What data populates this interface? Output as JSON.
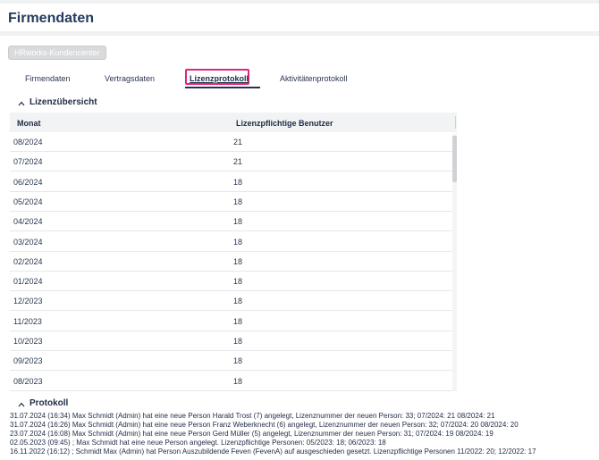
{
  "page": {
    "title": "Firmendaten"
  },
  "toolbar": {
    "kundencenter_label": "HRworks-Kundencenter"
  },
  "tabs": [
    {
      "label": "Firmendaten"
    },
    {
      "label": "Vertragsdaten"
    },
    {
      "label": "Lizenzprotokoll",
      "active": true
    },
    {
      "label": "Aktivitätenprotokoll"
    }
  ],
  "lizenz": {
    "section_title": "Lizenzübersicht",
    "columns": [
      "Monat",
      "Lizenzpflichtige Benutzer"
    ],
    "rows": [
      {
        "monat": "08/2024",
        "benutzer": "21"
      },
      {
        "monat": "07/2024",
        "benutzer": "21"
      },
      {
        "monat": "06/2024",
        "benutzer": "18"
      },
      {
        "monat": "05/2024",
        "benutzer": "18"
      },
      {
        "monat": "04/2024",
        "benutzer": "18"
      },
      {
        "monat": "03/2024",
        "benutzer": "18"
      },
      {
        "monat": "02/2024",
        "benutzer": "18"
      },
      {
        "monat": "01/2024",
        "benutzer": "18"
      },
      {
        "monat": "12/2023",
        "benutzer": "18"
      },
      {
        "monat": "11/2023",
        "benutzer": "18"
      },
      {
        "monat": "10/2023",
        "benutzer": "18"
      },
      {
        "monat": "09/2023",
        "benutzer": "18"
      },
      {
        "monat": "08/2023",
        "benutzer": "18"
      }
    ]
  },
  "protokoll": {
    "section_title": "Protokoll",
    "lines": [
      "31.07.2024 (16:34) Max Schmidt (Admin) hat eine neue Person Harald Trost (7) angelegt, Lizenznummer der neuen Person: 33; 07/2024: 21 08/2024: 21",
      "31.07.2024 (16:26) Max Schmidt (Admin) hat eine neue Person Franz Weberknecht (6) angelegt, Lizenznummer der neuen Person: 32; 07/2024: 20 08/2024: 20",
      "23.07.2024 (16:08) Max Schmidt (Admin) hat eine neue Person Gerd Müller (5) angelegt, Lizenznummer der neuen Person: 31; 07/2024: 19 08/2024: 19",
      "02.05.2023 (09:45) ; Max Schmidt hat eine neue Person angelegt. Lizenzpflichtige Personen: 05/2023: 18; 06/2023: 18",
      "16.11.2022 (16:12) ; Schmidt Max (Admin) hat Person Auszubildende Feven (FevenA) auf ausgeschieden gesetzt. Lizenzpflichtige Personen 11/2022: 20; 12/2022: 17"
    ]
  },
  "colors": {
    "accent": "#e0257f",
    "title": "#243b5e"
  }
}
